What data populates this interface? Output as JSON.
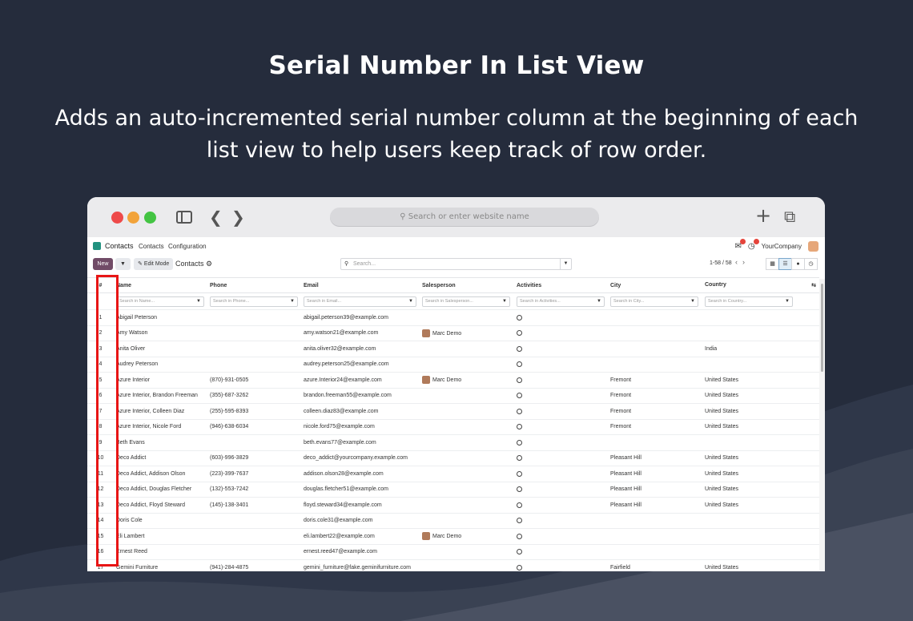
{
  "headline": "Serial Number In List View",
  "subline": "Adds an auto-incremented serial number column at the beginning of each list view to help users keep track of row order.",
  "browser": {
    "url_placeholder": "Search or enter website name",
    "new_tab_icon": "plus-icon",
    "tabs_icon": "tabs-icon"
  },
  "app": {
    "name": "Contacts",
    "menu": [
      "Contacts",
      "Configuration"
    ],
    "company": "YourCompany",
    "new_label": "New",
    "edit_mode_label": "Edit Mode",
    "breadcrumb": "Contacts",
    "search_placeholder": "Search...",
    "pager": "1-58 / 58"
  },
  "table": {
    "columns": [
      "#",
      "Name",
      "Phone",
      "Email",
      "Salesperson",
      "Activities",
      "City",
      "Country"
    ],
    "filters": [
      "Search in Name...",
      "Search in Phone...",
      "Search in Email...",
      "Search in Salesperson...",
      "Search in Activities...",
      "Search in City...",
      "Search in Country..."
    ],
    "rows": [
      {
        "n": "1",
        "name": "Abigail Peterson",
        "phone": "",
        "email": "abigail.peterson39@example.com",
        "sp": "",
        "city": "",
        "country": ""
      },
      {
        "n": "2",
        "name": "Amy Watson",
        "phone": "",
        "email": "amy.watson21@example.com",
        "sp": "Marc Demo",
        "city": "",
        "country": ""
      },
      {
        "n": "3",
        "name": "Anita Oliver",
        "phone": "",
        "email": "anita.oliver32@example.com",
        "sp": "",
        "city": "",
        "country": "India"
      },
      {
        "n": "4",
        "name": "Audrey Peterson",
        "phone": "",
        "email": "audrey.peterson25@example.com",
        "sp": "",
        "city": "",
        "country": ""
      },
      {
        "n": "5",
        "name": "Azure Interior",
        "phone": "(870)-931-0505",
        "email": "azure.Interior24@example.com",
        "sp": "Marc Demo",
        "city": "Fremont",
        "country": "United States"
      },
      {
        "n": "6",
        "name": "Azure Interior, Brandon Freeman",
        "phone": "(355)-687-3262",
        "email": "brandon.freeman55@example.com",
        "sp": "",
        "city": "Fremont",
        "country": "United States"
      },
      {
        "n": "7",
        "name": "Azure Interior, Colleen Diaz",
        "phone": "(255)-595-8393",
        "email": "colleen.diaz83@example.com",
        "sp": "",
        "city": "Fremont",
        "country": "United States"
      },
      {
        "n": "8",
        "name": "Azure Interior, Nicole Ford",
        "phone": "(946)-638-6034",
        "email": "nicole.ford75@example.com",
        "sp": "",
        "city": "Fremont",
        "country": "United States"
      },
      {
        "n": "9",
        "name": "Beth Evans",
        "phone": "",
        "email": "beth.evans77@example.com",
        "sp": "",
        "city": "",
        "country": ""
      },
      {
        "n": "10",
        "name": "Deco Addict",
        "phone": "(603)-996-3829",
        "email": "deco_addict@yourcompany.example.com",
        "sp": "",
        "city": "Pleasant Hill",
        "country": "United States"
      },
      {
        "n": "11",
        "name": "Deco Addict, Addison Olson",
        "phone": "(223)-399-7637",
        "email": "addison.olson28@example.com",
        "sp": "",
        "city": "Pleasant Hill",
        "country": "United States"
      },
      {
        "n": "12",
        "name": "Deco Addict, Douglas Fletcher",
        "phone": "(132)-553-7242",
        "email": "douglas.fletcher51@example.com",
        "sp": "",
        "city": "Pleasant Hill",
        "country": "United States"
      },
      {
        "n": "13",
        "name": "Deco Addict, Floyd Steward",
        "phone": "(145)-138-3401",
        "email": "floyd.steward34@example.com",
        "sp": "",
        "city": "Pleasant Hill",
        "country": "United States"
      },
      {
        "n": "14",
        "name": "Doris Cole",
        "phone": "",
        "email": "doris.cole31@example.com",
        "sp": "",
        "city": "",
        "country": ""
      },
      {
        "n": "15",
        "name": "Eli Lambert",
        "phone": "",
        "email": "eli.lambert22@example.com",
        "sp": "Marc Demo",
        "city": "",
        "country": ""
      },
      {
        "n": "16",
        "name": "Ernest Reed",
        "phone": "",
        "email": "ernest.reed47@example.com",
        "sp": "",
        "city": "",
        "country": ""
      },
      {
        "n": "17",
        "name": "Gemini Furniture",
        "phone": "(941)-284-4875",
        "email": "gemini_furniture@fake.geminifurniture.com",
        "sp": "",
        "city": "Fairfield",
        "country": "United States"
      }
    ]
  },
  "colors": {
    "background": "#252c3c",
    "brand": "#714b67",
    "highlight": "#e81515"
  }
}
